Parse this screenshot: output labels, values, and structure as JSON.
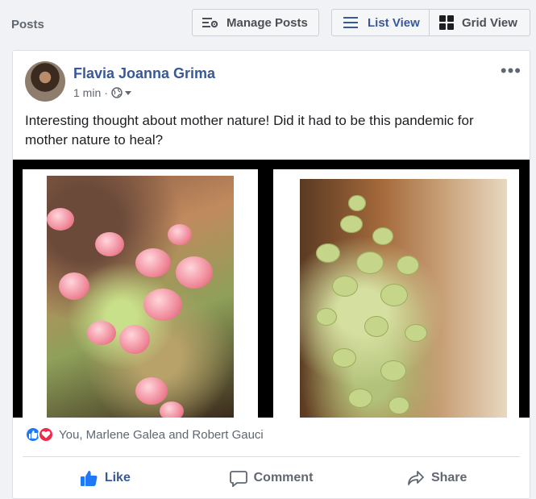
{
  "header": {
    "posts_label": "Posts",
    "manage_posts_label": "Manage Posts",
    "list_view_label": "List View",
    "grid_view_label": "Grid View"
  },
  "post": {
    "author": "Flavia Joanna Grima",
    "time": "1 min",
    "separator": "·",
    "privacy_icon": "globe-icon",
    "message": "Interesting thought about mother nature! Did it had to be this pandemic for mother nature to heal?",
    "reactions_text": "You, Marlene Galea and Robert Gauci",
    "actions": {
      "like": "Like",
      "comment": "Comment",
      "share": "Share"
    }
  },
  "colors": {
    "link_blue": "#385898",
    "like_blue": "#2078f4",
    "love_red": "#f0284a",
    "muted_text": "#606770"
  }
}
